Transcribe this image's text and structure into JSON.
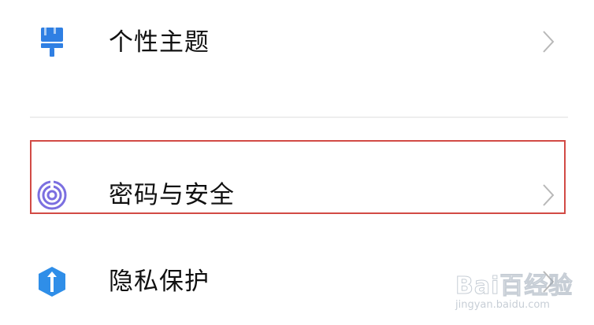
{
  "settings": {
    "items": [
      {
        "label": "个性主题",
        "icon": "paintbrush-icon",
        "icon_color": "#2f7fe3"
      },
      {
        "label": "密码与安全",
        "icon": "fingerprint-icon",
        "icon_color": "#7b6fe0",
        "highlighted": true
      },
      {
        "label": "隐私保护",
        "icon": "privacy-shield-icon",
        "icon_color": "#2f8ee8"
      }
    ]
  },
  "colors": {
    "highlight_border": "#d24a45",
    "divider": "#eeeeee",
    "chevron": "#b8b8b8",
    "text": "#111111"
  },
  "watermark": {
    "logo_text": "Bai百经验",
    "url": "jingyan.baidu.com"
  }
}
